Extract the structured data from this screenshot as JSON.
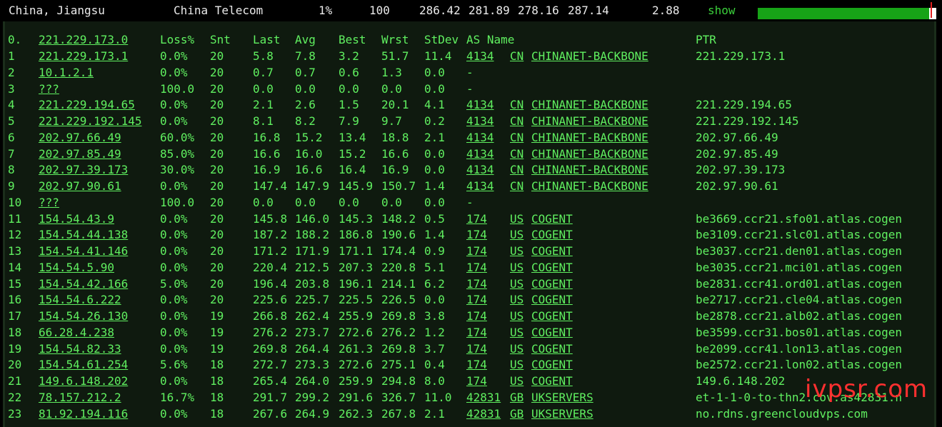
{
  "header": {
    "location": "China, Jiangsu",
    "isp": "China Telecom",
    "loss": "1%",
    "sent": "100",
    "last": "286.42",
    "avg": "281.89",
    "best": "278.16",
    "worst": "287.14",
    "stdev": "2.88",
    "show_label": "show",
    "bar_fill_fraction": 0.96
  },
  "columns": {
    "hop": "0.",
    "host": "221.229.173.0",
    "loss": "Loss%",
    "snt": "Snt",
    "last": "Last",
    "avg": "Avg",
    "best": "Best",
    "wrst": "Wrst",
    "stdev": "StDev",
    "as": "AS Name",
    "ptr": "PTR"
  },
  "hops": [
    {
      "n": "1",
      "host": "221.229.173.1",
      "loss": "0.0%",
      "snt": "20",
      "last": "5.8",
      "avg": "7.8",
      "best": "3.2",
      "wrst": "51.7",
      "stdev": "11.4",
      "asn": "4134",
      "cc": "CN",
      "asname": "CHINANET-BACKBONE",
      "ptr": "221.229.173.1"
    },
    {
      "n": "2",
      "host": "10.1.2.1",
      "loss": "0.0%",
      "snt": "20",
      "last": "0.7",
      "avg": "0.7",
      "best": "0.6",
      "wrst": "1.3",
      "stdev": "0.0",
      "asn": "-",
      "cc": "",
      "asname": "",
      "ptr": ""
    },
    {
      "n": "3",
      "host": "???",
      "loss": "100.0",
      "snt": "20",
      "last": "0.0",
      "avg": "0.0",
      "best": "0.0",
      "wrst": "0.0",
      "stdev": "0.0",
      "asn": "-",
      "cc": "",
      "asname": "",
      "ptr": ""
    },
    {
      "n": "4",
      "host": "221.229.194.65",
      "loss": "0.0%",
      "snt": "20",
      "last": "2.1",
      "avg": "2.6",
      "best": "1.5",
      "wrst": "20.1",
      "stdev": "4.1",
      "asn": "4134",
      "cc": "CN",
      "asname": "CHINANET-BACKBONE",
      "ptr": "221.229.194.65"
    },
    {
      "n": "5",
      "host": "221.229.192.145",
      "loss": "0.0%",
      "snt": "20",
      "last": "8.1",
      "avg": "8.2",
      "best": "7.9",
      "wrst": "9.7",
      "stdev": "0.2",
      "asn": "4134",
      "cc": "CN",
      "asname": "CHINANET-BACKBONE",
      "ptr": "221.229.192.145"
    },
    {
      "n": "6",
      "host": "202.97.66.49",
      "loss": "60.0%",
      "snt": "20",
      "last": "16.8",
      "avg": "15.2",
      "best": "13.4",
      "wrst": "18.8",
      "stdev": "2.1",
      "asn": "4134",
      "cc": "CN",
      "asname": "CHINANET-BACKBONE",
      "ptr": "202.97.66.49"
    },
    {
      "n": "7",
      "host": "202.97.85.49",
      "loss": "85.0%",
      "snt": "20",
      "last": "16.6",
      "avg": "16.0",
      "best": "15.2",
      "wrst": "16.6",
      "stdev": "0.0",
      "asn": "4134",
      "cc": "CN",
      "asname": "CHINANET-BACKBONE",
      "ptr": "202.97.85.49"
    },
    {
      "n": "8",
      "host": "202.97.39.173",
      "loss": "30.0%",
      "snt": "20",
      "last": "16.9",
      "avg": "16.6",
      "best": "16.4",
      "wrst": "16.9",
      "stdev": "0.0",
      "asn": "4134",
      "cc": "CN",
      "asname": "CHINANET-BACKBONE",
      "ptr": "202.97.39.173"
    },
    {
      "n": "9",
      "host": "202.97.90.61",
      "loss": "0.0%",
      "snt": "20",
      "last": "147.4",
      "avg": "147.9",
      "best": "145.9",
      "wrst": "150.7",
      "stdev": "1.4",
      "asn": "4134",
      "cc": "CN",
      "asname": "CHINANET-BACKBONE",
      "ptr": "202.97.90.61"
    },
    {
      "n": "10",
      "host": "???",
      "loss": "100.0",
      "snt": "20",
      "last": "0.0",
      "avg": "0.0",
      "best": "0.0",
      "wrst": "0.0",
      "stdev": "0.0",
      "asn": "-",
      "cc": "",
      "asname": "",
      "ptr": ""
    },
    {
      "n": "11",
      "host": "154.54.43.9",
      "loss": "0.0%",
      "snt": "20",
      "last": "145.8",
      "avg": "146.0",
      "best": "145.3",
      "wrst": "148.2",
      "stdev": "0.5",
      "asn": "174",
      "cc": "US",
      "asname": "COGENT",
      "ptr": "be3669.ccr21.sfo01.atlas.cogen"
    },
    {
      "n": "12",
      "host": "154.54.44.138",
      "loss": "0.0%",
      "snt": "20",
      "last": "187.2",
      "avg": "188.2",
      "best": "186.8",
      "wrst": "190.6",
      "stdev": "1.4",
      "asn": "174",
      "cc": "US",
      "asname": "COGENT",
      "ptr": "be3109.ccr21.slc01.atlas.cogen"
    },
    {
      "n": "13",
      "host": "154.54.41.146",
      "loss": "0.0%",
      "snt": "20",
      "last": "171.2",
      "avg": "171.9",
      "best": "171.1",
      "wrst": "174.4",
      "stdev": "0.9",
      "asn": "174",
      "cc": "US",
      "asname": "COGENT",
      "ptr": "be3037.ccr21.den01.atlas.cogen"
    },
    {
      "n": "14",
      "host": "154.54.5.90",
      "loss": "0.0%",
      "snt": "20",
      "last": "220.4",
      "avg": "212.5",
      "best": "207.3",
      "wrst": "220.8",
      "stdev": "5.1",
      "asn": "174",
      "cc": "US",
      "asname": "COGENT",
      "ptr": "be3035.ccr21.mci01.atlas.cogen"
    },
    {
      "n": "15",
      "host": "154.54.42.166",
      "loss": "5.0%",
      "snt": "20",
      "last": "196.4",
      "avg": "203.8",
      "best": "196.1",
      "wrst": "214.1",
      "stdev": "6.2",
      "asn": "174",
      "cc": "US",
      "asname": "COGENT",
      "ptr": "be2831.ccr41.ord01.atlas.cogen"
    },
    {
      "n": "16",
      "host": "154.54.6.222",
      "loss": "0.0%",
      "snt": "20",
      "last": "225.6",
      "avg": "225.7",
      "best": "225.5",
      "wrst": "226.5",
      "stdev": "0.0",
      "asn": "174",
      "cc": "US",
      "asname": "COGENT",
      "ptr": "be2717.ccr21.cle04.atlas.cogen"
    },
    {
      "n": "17",
      "host": "154.54.26.130",
      "loss": "0.0%",
      "snt": "19",
      "last": "266.8",
      "avg": "262.4",
      "best": "255.9",
      "wrst": "269.8",
      "stdev": "3.8",
      "asn": "174",
      "cc": "US",
      "asname": "COGENT",
      "ptr": "be2878.ccr21.alb02.atlas.cogen"
    },
    {
      "n": "18",
      "host": "66.28.4.238",
      "loss": "0.0%",
      "snt": "19",
      "last": "276.2",
      "avg": "273.7",
      "best": "272.6",
      "wrst": "276.2",
      "stdev": "1.2",
      "asn": "174",
      "cc": "US",
      "asname": "COGENT",
      "ptr": "be3599.ccr31.bos01.atlas.cogen"
    },
    {
      "n": "19",
      "host": "154.54.82.33",
      "loss": "0.0%",
      "snt": "19",
      "last": "269.8",
      "avg": "264.4",
      "best": "261.3",
      "wrst": "269.8",
      "stdev": "3.7",
      "asn": "174",
      "cc": "US",
      "asname": "COGENT",
      "ptr": "be2099.ccr41.lon13.atlas.cogen"
    },
    {
      "n": "20",
      "host": "154.54.61.254",
      "loss": "5.6%",
      "snt": "18",
      "last": "272.7",
      "avg": "273.3",
      "best": "272.6",
      "wrst": "275.1",
      "stdev": "0.4",
      "asn": "174",
      "cc": "US",
      "asname": "COGENT",
      "ptr": "be2572.ccr21.lon02.atlas.cogen"
    },
    {
      "n": "21",
      "host": "149.6.148.202",
      "loss": "0.0%",
      "snt": "18",
      "last": "265.4",
      "avg": "264.0",
      "best": "259.9",
      "wrst": "294.8",
      "stdev": "8.0",
      "asn": "174",
      "cc": "US",
      "asname": "COGENT",
      "ptr": "149.6.148.202"
    },
    {
      "n": "22",
      "host": "78.157.212.2",
      "loss": "16.7%",
      "snt": "18",
      "last": "291.7",
      "avg": "299.2",
      "best": "291.6",
      "wrst": "326.7",
      "stdev": "11.0",
      "asn": "42831",
      "cc": "GB",
      "asname": "UKSERVERS",
      "ptr": "et-1-1-0-to-thn2.cov.as42831.n"
    },
    {
      "n": "23",
      "host": "81.92.194.116",
      "loss": "0.0%",
      "snt": "18",
      "last": "267.6",
      "avg": "264.9",
      "best": "262.3",
      "wrst": "267.8",
      "stdev": "2.1",
      "asn": "42831",
      "cc": "GB",
      "asname": "UKSERVERS",
      "ptr": "no.rdns.greencloudvps.com"
    }
  ],
  "watermark": "ivpsr.com"
}
